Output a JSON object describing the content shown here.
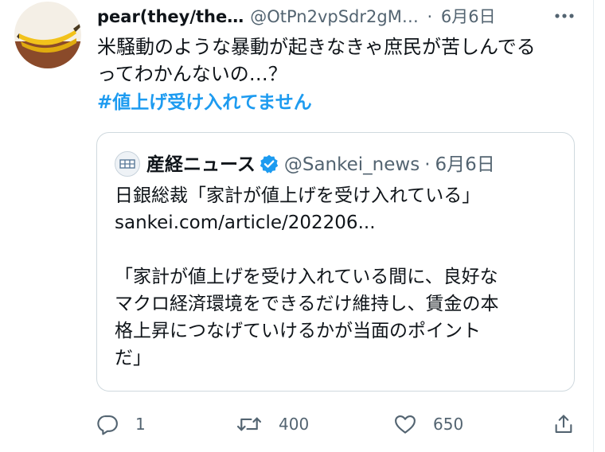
{
  "tweet": {
    "display_name": "pear(they/the…",
    "handle": "@OtPn2vpSdr2gM…",
    "separator": "·",
    "date": "6月6日",
    "text_line1": "米騒動のような暴動が起きなきゃ庶民が苦しんでる",
    "text_line2": "ってわかんないの…？",
    "hashtag": "#値上げ受け入れてません",
    "more_icon": "more-dots-icon",
    "avatar_icon": "banana-avatar"
  },
  "quote": {
    "name": "産経ニュース",
    "handle": "@Sankei_news",
    "separator": "·",
    "date": "6月6日",
    "headline": "日銀総裁「家計が値上げを受け入れている」",
    "link": "sankei.com/article/202206...",
    "body_line1": "「家計が値上げを受け入れている間に、良好な",
    "body_line2": "マクロ経済環境をできるだけ維持し、賃金の本",
    "body_line3": "格上昇につなげていけるかが当面のポイント",
    "body_line4": "だ」",
    "logo_icon": "sankei-logo",
    "verified_icon": "verified-badge-icon"
  },
  "actions": {
    "reply_count": "1",
    "retweet_count": "400",
    "like_count": "650",
    "reply_icon": "reply-icon",
    "retweet_icon": "retweet-icon",
    "like_icon": "heart-icon",
    "share_icon": "share-icon"
  },
  "colors": {
    "accent": "#1d9bf0",
    "text": "#0f1419",
    "muted": "#536471",
    "border": "#cfd9de"
  }
}
